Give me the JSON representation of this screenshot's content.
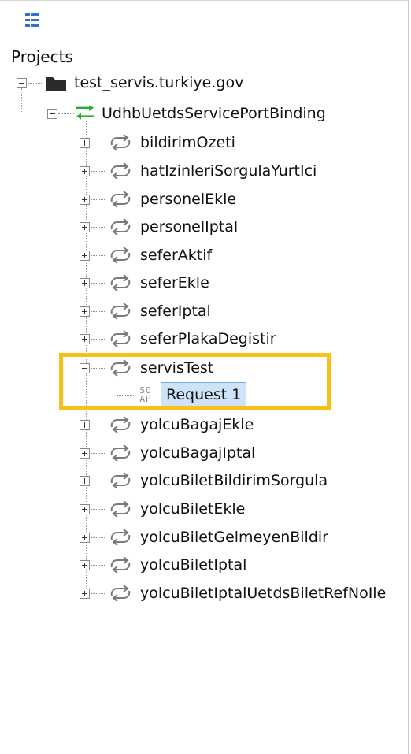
{
  "projects_panel": {
    "header": "Projects",
    "project": {
      "name": "test_servis.turkiye.gov"
    },
    "binding": {
      "name": "UdhbUetdsServicePortBinding"
    },
    "operations": [
      {
        "name": "bildirimOzeti"
      },
      {
        "name": "hatIzinleriSorgulaYurtIci"
      },
      {
        "name": "personelEkle"
      },
      {
        "name": "personelIptal"
      },
      {
        "name": "seferAktif"
      },
      {
        "name": "seferEkle"
      },
      {
        "name": "seferIptal"
      },
      {
        "name": "seferPlakaDegistir"
      },
      {
        "name": "servisTest"
      },
      {
        "name": "yolcuBagajEkle"
      },
      {
        "name": "yolcuBagajIptal"
      },
      {
        "name": "yolcuBiletBildirimSorgula"
      },
      {
        "name": "yolcuBiletEkle"
      },
      {
        "name": "yolcuBiletGelmeyenBildir"
      },
      {
        "name": "yolcuBiletIptal"
      },
      {
        "name": "yolcuBiletIptalUetdsBiletRefNoIle"
      }
    ],
    "request": {
      "type_badge_top": "SO",
      "type_badge_bottom": "AP",
      "name": "Request 1"
    }
  },
  "colors": {
    "highlight_box": "#f7c01a",
    "binding_icon": "#2eaa3c",
    "selection_bg": "#cce3f8",
    "toolbar_icon": "#2f6fd0"
  },
  "icons": {
    "toolbar": "tree-view-icon",
    "project": "folder-icon",
    "binding": "bidirectional-arrows-icon",
    "operation": "refresh-arrows-icon",
    "request": "soap-icon"
  }
}
